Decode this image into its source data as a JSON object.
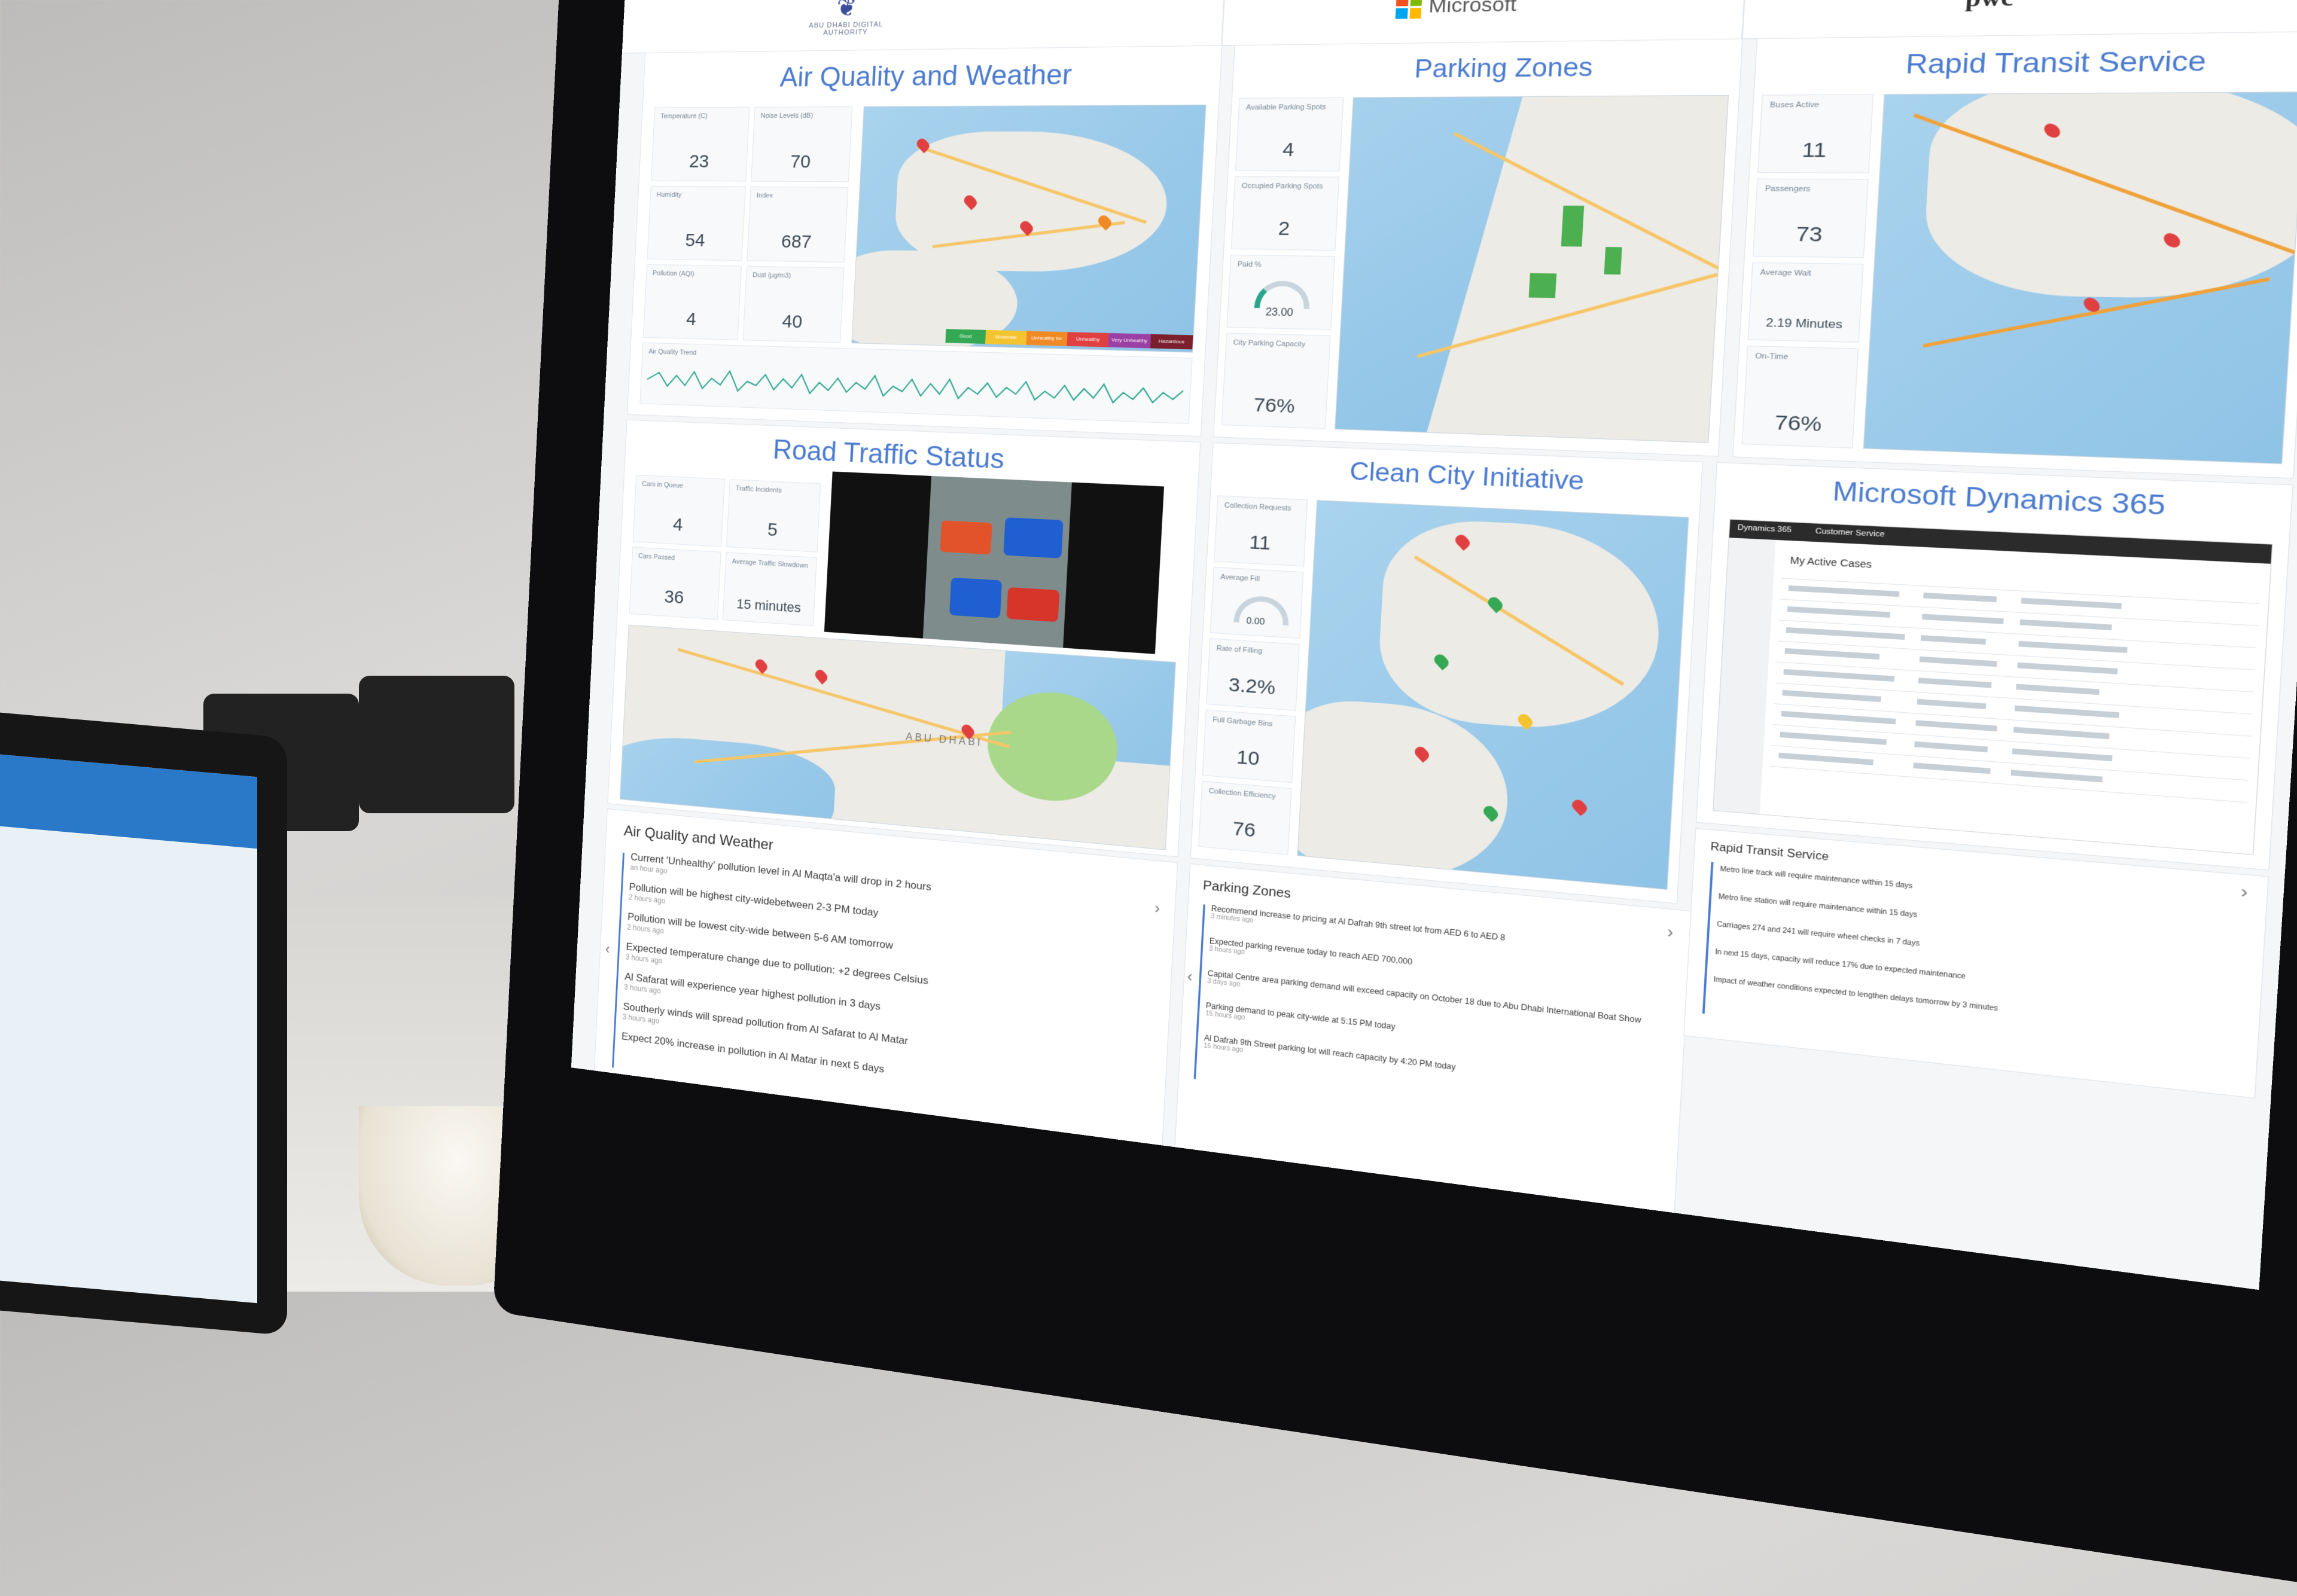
{
  "header": {
    "authority_logo_text": "ABU DHABI DIGITAL AUTHORITY",
    "microsoft_logo_text": "Microsoft",
    "pwc_logo_text": "pwc"
  },
  "air_quality": {
    "title": "Air Quality and Weather",
    "tiles": [
      {
        "label": "Temperature (C)",
        "value": "23"
      },
      {
        "label": "Noise Levels (dB)",
        "value": "70"
      },
      {
        "label": "Humidity",
        "value": "54"
      },
      {
        "label": "Index",
        "value": "687"
      },
      {
        "label": "Pollution (AQI)",
        "value": "4"
      },
      {
        "label": "Dust (µg/m3)",
        "value": "40"
      }
    ],
    "trend_label": "Air Quality Trend",
    "legend": [
      "Good",
      "Moderate",
      "Unhealthy for Sensitive",
      "Unhealthy",
      "Very Unhealthy",
      "Hazardous"
    ],
    "legend_colors": [
      "#34a853",
      "#f4c430",
      "#f08a24",
      "#e04040",
      "#9b3fa4",
      "#7a1f2b"
    ]
  },
  "parking": {
    "title": "Parking Zones",
    "tiles": [
      {
        "label": "Available Parking Spots",
        "value": "4"
      },
      {
        "label": "Occupied Parking Spots",
        "value": "2"
      },
      {
        "label": "Paid %",
        "value": "23.00"
      },
      {
        "label": "City Parking Capacity",
        "value": "76%"
      }
    ]
  },
  "transit": {
    "title": "Rapid Transit Service",
    "tiles": [
      {
        "label": "Buses Active",
        "value": "11"
      },
      {
        "label": "Passengers",
        "value": "73"
      },
      {
        "label": "Average Wait",
        "value": "2.19 Minutes"
      },
      {
        "label": "On-Time",
        "value": "76%"
      }
    ]
  },
  "traffic": {
    "title": "Road Traffic Status",
    "tiles": [
      {
        "label": "Cars in Queue",
        "value": "4"
      },
      {
        "label": "Traffic Incidents",
        "value": "5"
      },
      {
        "label": "Cars Passed",
        "value": "36"
      },
      {
        "label": "Average Traffic Slowdown",
        "value": "15 minutes"
      }
    ],
    "map_label": "ABU DHABI"
  },
  "clean_city": {
    "title": "Clean City Initiative",
    "tiles": [
      {
        "label": "Collection Requests",
        "value": "11"
      },
      {
        "label": "Average Fill",
        "value": "0.00"
      },
      {
        "label": "Rate of Filling",
        "value": "3.2%"
      },
      {
        "label": "Full Garbage Bins",
        "value": "10"
      },
      {
        "label": "Collection Efficiency",
        "value": "76"
      }
    ]
  },
  "dynamics": {
    "title": "Microsoft Dynamics 365",
    "nav_items": [
      "Dynamics 365",
      "Customer Service"
    ],
    "view_title": "My Active Cases"
  },
  "feeds": {
    "air": {
      "title": "Air Quality and Weather",
      "items": [
        {
          "text": "Current 'Unhealthy' pollution level in Al Maqta'a will drop in 2 hours",
          "ago": "an hour ago"
        },
        {
          "text": "Pollution will be highest city-widebetween 2-3 PM today",
          "ago": "2 hours ago"
        },
        {
          "text": "Pollution will be lowest city-wide between 5-6 AM tomorrow",
          "ago": "2 hours ago"
        },
        {
          "text": "Expected temperature change due to pollution: +2 degrees Celsius",
          "ago": "3 hours ago"
        },
        {
          "text": "Al Safarat will experience year highest pollution in 3 days",
          "ago": "3 hours ago"
        },
        {
          "text": "Southerly winds will spread pollution from Al Safarat to Al Matar",
          "ago": "3 hours ago"
        },
        {
          "text": "Expect 20% increase in pollution in Al Matar in next 5 days",
          "ago": ""
        }
      ]
    },
    "parking": {
      "title": "Parking Zones",
      "items": [
        {
          "text": "Recommend increase to pricing at Al Dafrah 9th street lot from AED 6 to AED 8",
          "ago": "3 minutes ago"
        },
        {
          "text": "Expected parking revenue today to reach AED 700,000",
          "ago": "3 hours ago"
        },
        {
          "text": "Capital Centre area parking demand will exceed capacity on October 18 due to Abu Dhabi International Boat Show",
          "ago": "3 days ago"
        },
        {
          "text": "Parking demand to peak city-wide at 5:15 PM today",
          "ago": "15 hours ago"
        },
        {
          "text": "Al Dafrah 9th Street parking lot will reach capacity by 4:20 PM today",
          "ago": "15 hours ago"
        }
      ]
    },
    "transit": {
      "title": "Rapid Transit Service",
      "items": [
        {
          "text": "Metro line track will require maintenance within 15 days",
          "ago": ""
        },
        {
          "text": "Metro line station will require maintenance within 15 days",
          "ago": ""
        },
        {
          "text": "Carriages 274 and 241 will require wheel checks in 7 days",
          "ago": ""
        },
        {
          "text": "In next 15 days, capacity will reduce 17% due to expected maintenance",
          "ago": ""
        },
        {
          "text": "Impact of weather conditions expected to lengthen delays tomorrow by 3 minutes",
          "ago": ""
        }
      ]
    }
  }
}
